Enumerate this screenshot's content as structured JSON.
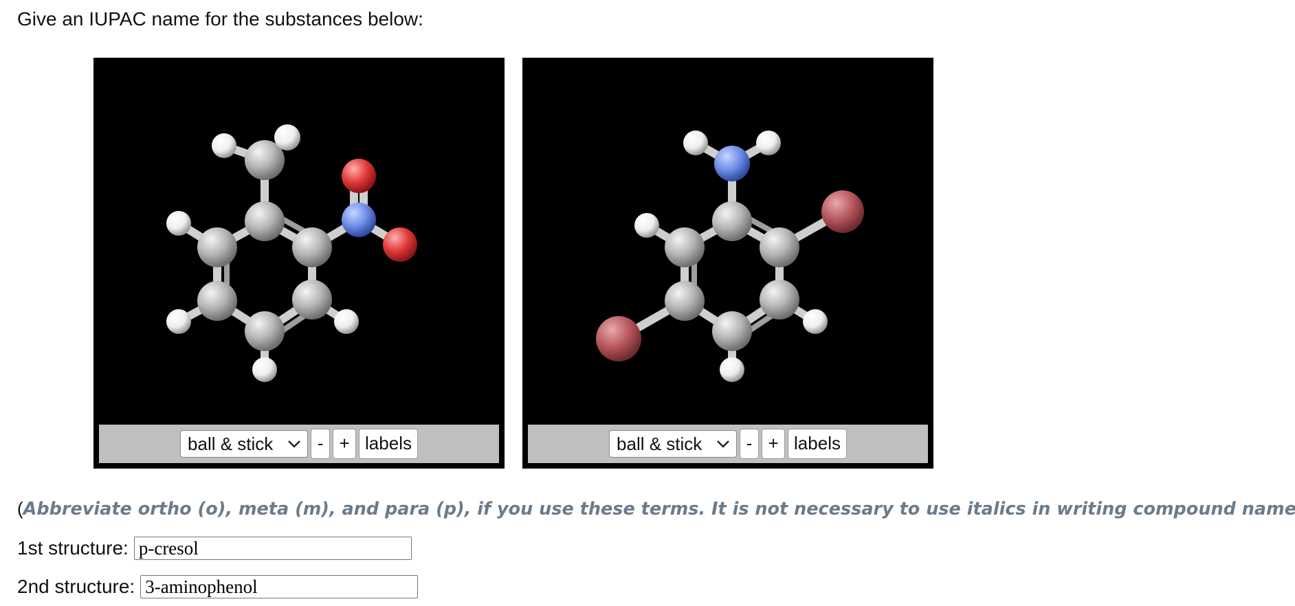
{
  "prompt": "Give an IUPAC name for the substances below:",
  "viewers": [
    {
      "display_mode": "ball & stick",
      "minus_label": "-",
      "plus_label": "+",
      "labels_label": "labels"
    },
    {
      "display_mode": "ball & stick",
      "minus_label": "-",
      "plus_label": "+",
      "labels_label": "labels"
    }
  ],
  "note": {
    "open": "(",
    "text": "Abbreviate ortho (o), meta (m), and para (p), if you use these terms. It is not necessary to use italics in writing compound names.",
    "close": ")"
  },
  "answers": [
    {
      "label": "1st structure:",
      "value": "p-cresol"
    },
    {
      "label": "2nd structure:",
      "value": "3-aminophenol"
    }
  ],
  "colors": {
    "carbon": "#b5b5b5",
    "hydrogen": "#f2f2f2",
    "nitrogen": "#6f8ee8",
    "oxygen": "#e23a3a",
    "bromine": "#b8585f",
    "note_text": "#6c7b8b"
  }
}
